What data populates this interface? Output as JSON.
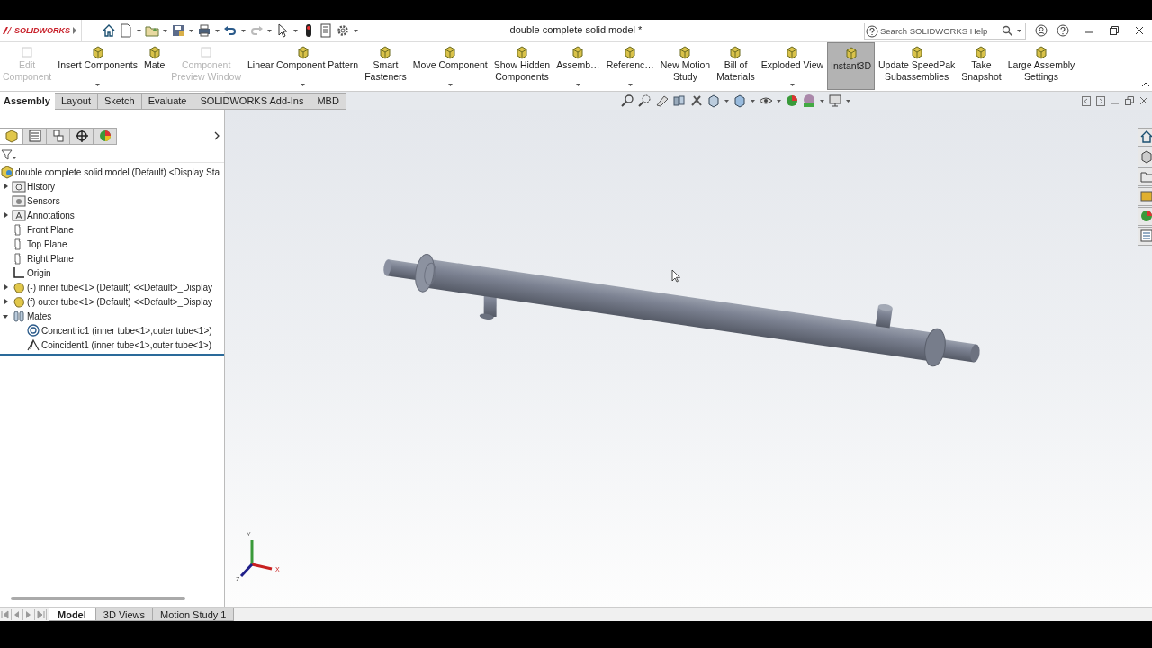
{
  "window": {
    "logo": "SOLIDWORKS",
    "title": "double complete solid model *"
  },
  "search": {
    "placeholder": "Search SOLIDWORKS Help"
  },
  "ribbon": [
    {
      "label": "Edit\nComponent",
      "disabled": true,
      "dropdown": false,
      "on": false
    },
    {
      "label": "Insert Components",
      "disabled": false,
      "dropdown": true,
      "on": false
    },
    {
      "label": "Mate",
      "disabled": false,
      "dropdown": false,
      "on": false
    },
    {
      "label": "Component\nPreview Window",
      "disabled": true,
      "dropdown": false,
      "on": false
    },
    {
      "label": "Linear Component Pattern",
      "disabled": false,
      "dropdown": true,
      "on": false
    },
    {
      "label": "Smart\nFasteners",
      "disabled": false,
      "dropdown": false,
      "on": false
    },
    {
      "label": "Move Component",
      "disabled": false,
      "dropdown": true,
      "on": false
    },
    {
      "label": "Show Hidden\nComponents",
      "disabled": false,
      "dropdown": false,
      "on": false
    },
    {
      "label": "Assemb…",
      "disabled": false,
      "dropdown": true,
      "on": false
    },
    {
      "label": "Referenc…",
      "disabled": false,
      "dropdown": true,
      "on": false
    },
    {
      "label": "New Motion\nStudy",
      "disabled": false,
      "dropdown": false,
      "on": false
    },
    {
      "label": "Bill of\nMaterials",
      "disabled": false,
      "dropdown": false,
      "on": false
    },
    {
      "label": "Exploded View",
      "disabled": false,
      "dropdown": true,
      "on": false
    },
    {
      "label": "Instant3D",
      "disabled": false,
      "dropdown": false,
      "on": true
    },
    {
      "label": "Update SpeedPak\nSubassemblies",
      "disabled": false,
      "dropdown": false,
      "on": false
    },
    {
      "label": "Take\nSnapshot",
      "disabled": false,
      "dropdown": false,
      "on": false
    },
    {
      "label": "Large Assembly\nSettings",
      "disabled": false,
      "dropdown": false,
      "on": false
    }
  ],
  "command_tabs": [
    {
      "label": "Assembly",
      "selected": true
    },
    {
      "label": "Layout",
      "selected": false
    },
    {
      "label": "Sketch",
      "selected": false
    },
    {
      "label": "Evaluate",
      "selected": false
    },
    {
      "label": "SOLIDWORKS Add-Ins",
      "selected": false
    },
    {
      "label": "MBD",
      "selected": false
    }
  ],
  "panel_tabs": [
    {
      "kind": "tree",
      "selected": true
    },
    {
      "kind": "property",
      "selected": false
    },
    {
      "kind": "config",
      "selected": false
    },
    {
      "kind": "dimxpert",
      "selected": false
    },
    {
      "kind": "display",
      "selected": false
    }
  ],
  "tree": {
    "label": "double complete solid model (Default) <Display Sta",
    "kind": "assembly",
    "children": [
      {
        "label": "History",
        "kind": "history",
        "expanded": false
      },
      {
        "label": "Sensors",
        "kind": "sensor"
      },
      {
        "label": "Annotations",
        "kind": "annotation",
        "expanded": false
      },
      {
        "label": "Front Plane",
        "kind": "plane"
      },
      {
        "label": "Top Plane",
        "kind": "plane"
      },
      {
        "label": "Right Plane",
        "kind": "plane"
      },
      {
        "label": "Origin",
        "kind": "origin"
      },
      {
        "label": "(-) inner tube<1> (Default) <<Default>_Display",
        "kind": "part",
        "expanded": false
      },
      {
        "label": "(f) outer tube<1> (Default) <<Default>_Display",
        "kind": "part",
        "expanded": false
      },
      {
        "label": "Mates",
        "kind": "mates",
        "expanded": true,
        "children": [
          {
            "label": "Concentric1 (inner tube<1>,outer tube<1>)",
            "kind": "concentric"
          },
          {
            "label": "Coincident1 (inner tube<1>,outer tube<1>)",
            "kind": "coincident"
          }
        ]
      }
    ]
  },
  "triad": [
    "X",
    "Y",
    "Z"
  ],
  "bottom_tabs": [
    {
      "label": "Model",
      "selected": true
    },
    {
      "label": "3D Views",
      "selected": false
    },
    {
      "label": "Motion Study 1",
      "selected": false
    }
  ]
}
